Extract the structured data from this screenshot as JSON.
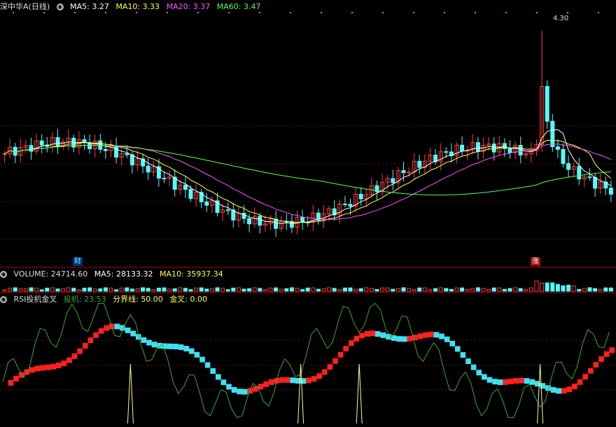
{
  "main_panel": {
    "title": "深中华A(日线)",
    "ma5_label": "MA5:",
    "ma5_value": "3.27",
    "ma10_label": "MA10:",
    "ma10_value": "3.33",
    "ma20_label": "MA20:",
    "ma20_value": "3.37",
    "ma60_label": "MA60:",
    "ma60_value": "3.47",
    "high_label": "4.30",
    "marker_left": "财",
    "marker_right": "涨"
  },
  "volume_panel": {
    "volume_label": "VOLUME:",
    "volume_value": "24714.60",
    "ma5_label": "MA5:",
    "ma5_value": "28133.32",
    "ma10_label": "MA10:",
    "ma10_value": "35937.34"
  },
  "rsi_panel": {
    "title": "RSI投机金叉",
    "spec_label": "投机:",
    "spec_value": "23.53",
    "line_label": "分界线:",
    "line_value": "50.00",
    "cross_label": "金叉:",
    "cross_value": "0.00"
  },
  "colors": {
    "up": "#ff3c3c",
    "down": "#54fcfc",
    "ma5": "#ffffff",
    "ma10": "#ffff54",
    "ma20": "#ff54ff",
    "ma60": "#54ff54",
    "rsi_up": "#ff2020",
    "rsi_down": "#40e0f0",
    "rsi_line": "#3aa43a",
    "cross": "#ffff80"
  },
  "chart_data": {
    "type": "candlestick",
    "ylim": [
      2.75,
      4.45
    ],
    "high": 4.3,
    "ma_latest": {
      "MA5": 3.27,
      "MA10": 3.33,
      "MA20": 3.37,
      "MA60": 3.47
    },
    "volume_latest": {
      "VOLUME": 24714.6,
      "MA5": 28133.32,
      "MA10": 35937.34
    },
    "rsi_latest": {
      "投机": 23.53,
      "分界线": 50.0,
      "金叉": 0.0
    }
  }
}
